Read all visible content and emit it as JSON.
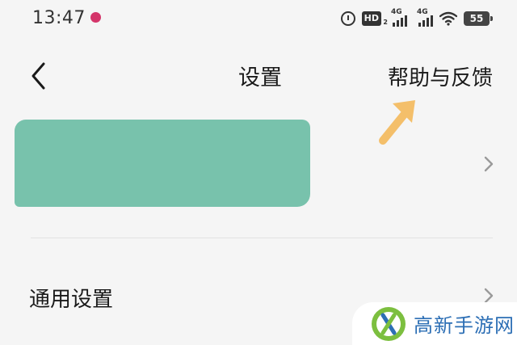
{
  "status_bar": {
    "time": "13:47",
    "hd_label": "HD",
    "hd_sub": "2",
    "network_1": "4G",
    "network_2": "4G",
    "battery": "55"
  },
  "header": {
    "title": "设置",
    "help_link": "帮助与反馈"
  },
  "settings": {
    "general": "通用设置"
  },
  "watermark": {
    "text": "高新手游网"
  },
  "colors": {
    "background": "#f5f5f5",
    "redaction": "#78c2ac",
    "annotation_arrow": "#f4bf6a",
    "watermark_text": "#2d6fb5"
  },
  "icons": {
    "back": "chevron-left-icon",
    "row": "chevron-right-icon",
    "alarm": "alarm-icon",
    "wifi": "wifi-icon"
  }
}
